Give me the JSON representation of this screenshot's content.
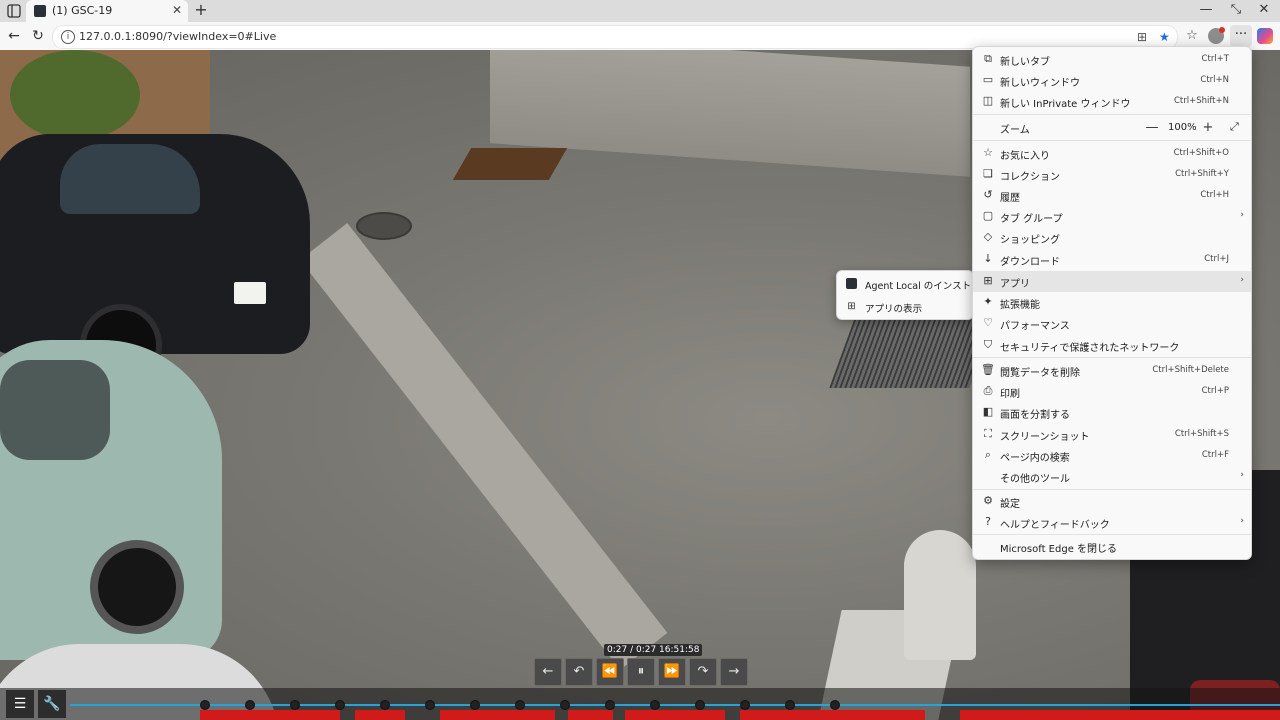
{
  "browser": {
    "tab_title": "(1) GSC-19",
    "url": "127.0.0.1:8090/?viewIndex=0#Live",
    "minimize_glyph": "—",
    "restore_glyph": "⤡",
    "close_glyph": "✕"
  },
  "menu": {
    "items": [
      {
        "icon": "new-tab-icon",
        "label": "新しいタブ",
        "shortcut": "Ctrl+T"
      },
      {
        "icon": "new-window-icon",
        "label": "新しいウィンドウ",
        "shortcut": "Ctrl+N"
      },
      {
        "icon": "inprivate-icon",
        "label": "新しい InPrivate ウィンドウ",
        "shortcut": "Ctrl+Shift+N"
      },
      {
        "icon": "",
        "label": "ズーム",
        "shortcut": ""
      },
      {
        "icon": "favorites-icon",
        "label": "お気に入り",
        "shortcut": "Ctrl+Shift+O"
      },
      {
        "icon": "collections-icon",
        "label": "コレクション",
        "shortcut": "Ctrl+Shift+Y"
      },
      {
        "icon": "history-icon",
        "label": "履歴",
        "shortcut": "Ctrl+H"
      },
      {
        "icon": "tab-groups-icon",
        "label": "タブ グループ",
        "shortcut": ""
      },
      {
        "icon": "shopping-icon",
        "label": "ショッピング",
        "shortcut": ""
      },
      {
        "icon": "download-icon",
        "label": "ダウンロード",
        "shortcut": "Ctrl+J"
      },
      {
        "icon": "apps-icon",
        "label": "アプリ",
        "shortcut": ""
      },
      {
        "icon": "extensions-icon",
        "label": "拡張機能",
        "shortcut": ""
      },
      {
        "icon": "performance-icon",
        "label": "パフォーマンス",
        "shortcut": ""
      },
      {
        "icon": "secure-network-icon",
        "label": "セキュリティで保護されたネットワーク",
        "shortcut": ""
      },
      {
        "icon": "delete-icon",
        "label": "閲覧データを削除",
        "shortcut": "Ctrl+Shift+Delete"
      },
      {
        "icon": "print-icon",
        "label": "印刷",
        "shortcut": "Ctrl+P"
      },
      {
        "icon": "split-screen-icon",
        "label": "画面を分割する",
        "shortcut": ""
      },
      {
        "icon": "screenshot-icon",
        "label": "スクリーンショット",
        "shortcut": "Ctrl+Shift+S"
      },
      {
        "icon": "find-icon",
        "label": "ページ内の検索",
        "shortcut": "Ctrl+F"
      },
      {
        "icon": "",
        "label": "その他のツール",
        "shortcut": ""
      },
      {
        "icon": "settings-icon",
        "label": "設定",
        "shortcut": ""
      },
      {
        "icon": "help-icon",
        "label": "ヘルプとフィードバック",
        "shortcut": ""
      },
      {
        "icon": "",
        "label": "Microsoft Edge を閉じる",
        "shortcut": ""
      }
    ],
    "zoom_value": "100%",
    "zoom_minus": "—",
    "zoom_plus": "+",
    "submenu_arrow": "›"
  },
  "submenu": {
    "items": [
      {
        "icon": "agent-app-icon",
        "label": "Agent Local のインストール"
      },
      {
        "icon": "apps-grid-icon",
        "label": "アプリの表示"
      }
    ]
  },
  "player": {
    "timestamp": "0:27 / 0:27 16:51:58",
    "controls": [
      "←",
      "↶",
      "⏪",
      "⏸",
      "⏩",
      "↷",
      "→"
    ]
  },
  "colors": {
    "accent": "#26a3d9",
    "record": "#d11b1b",
    "menu_highlight": "#e5e5e5"
  }
}
